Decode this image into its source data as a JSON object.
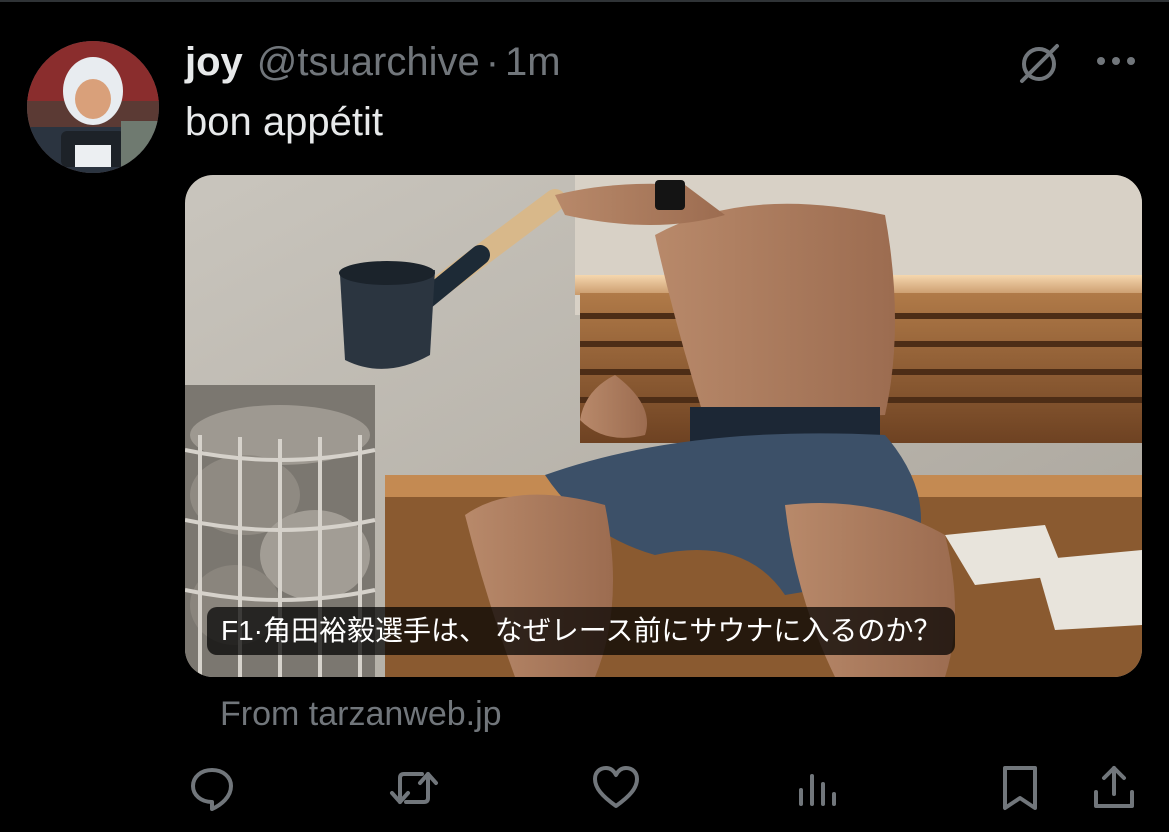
{
  "tweet": {
    "author": {
      "display_name": "joy",
      "handle": "@tsuarchive",
      "separator": "·",
      "timestamp": "1m"
    },
    "text": "bon appétit",
    "link_card": {
      "title": "F1·角田裕毅選手は、 なぜレース前にサウナに入るのか？",
      "source": "From tarzanweb.jp"
    }
  },
  "icons": {
    "grok": "grok-icon",
    "more": "more-icon",
    "reply": "reply-icon",
    "retweet": "retweet-icon",
    "like": "like-icon",
    "views": "views-icon",
    "bookmark": "bookmark-icon",
    "share": "share-icon"
  },
  "colors": {
    "background": "#000000",
    "primary_text": "#e7e9ea",
    "secondary_text": "#71767b",
    "icon": "#71767b"
  }
}
